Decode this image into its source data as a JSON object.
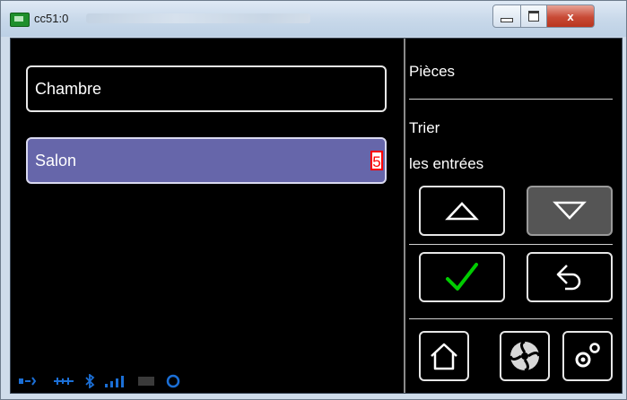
{
  "window": {
    "title": "cc51:0",
    "close_label": "x"
  },
  "list": {
    "items": [
      {
        "label": "Chambre",
        "selected": false
      },
      {
        "label": "Salon",
        "selected": true,
        "badge": "5"
      }
    ]
  },
  "side": {
    "title": "Pièces",
    "sort_line1": "Trier",
    "sort_line2": "les entrées"
  },
  "icons": {
    "up": "triangle-up-icon",
    "down": "triangle-down-icon",
    "confirm": "checkmark-icon",
    "back": "back-arrow-icon",
    "home": "home-icon",
    "fan": "fan-icon",
    "settings": "gear-icon"
  },
  "colors": {
    "selected_item": "#6666aa",
    "check": "#00cc00",
    "status": "#1b6fd6",
    "badge": "#ff0000"
  }
}
